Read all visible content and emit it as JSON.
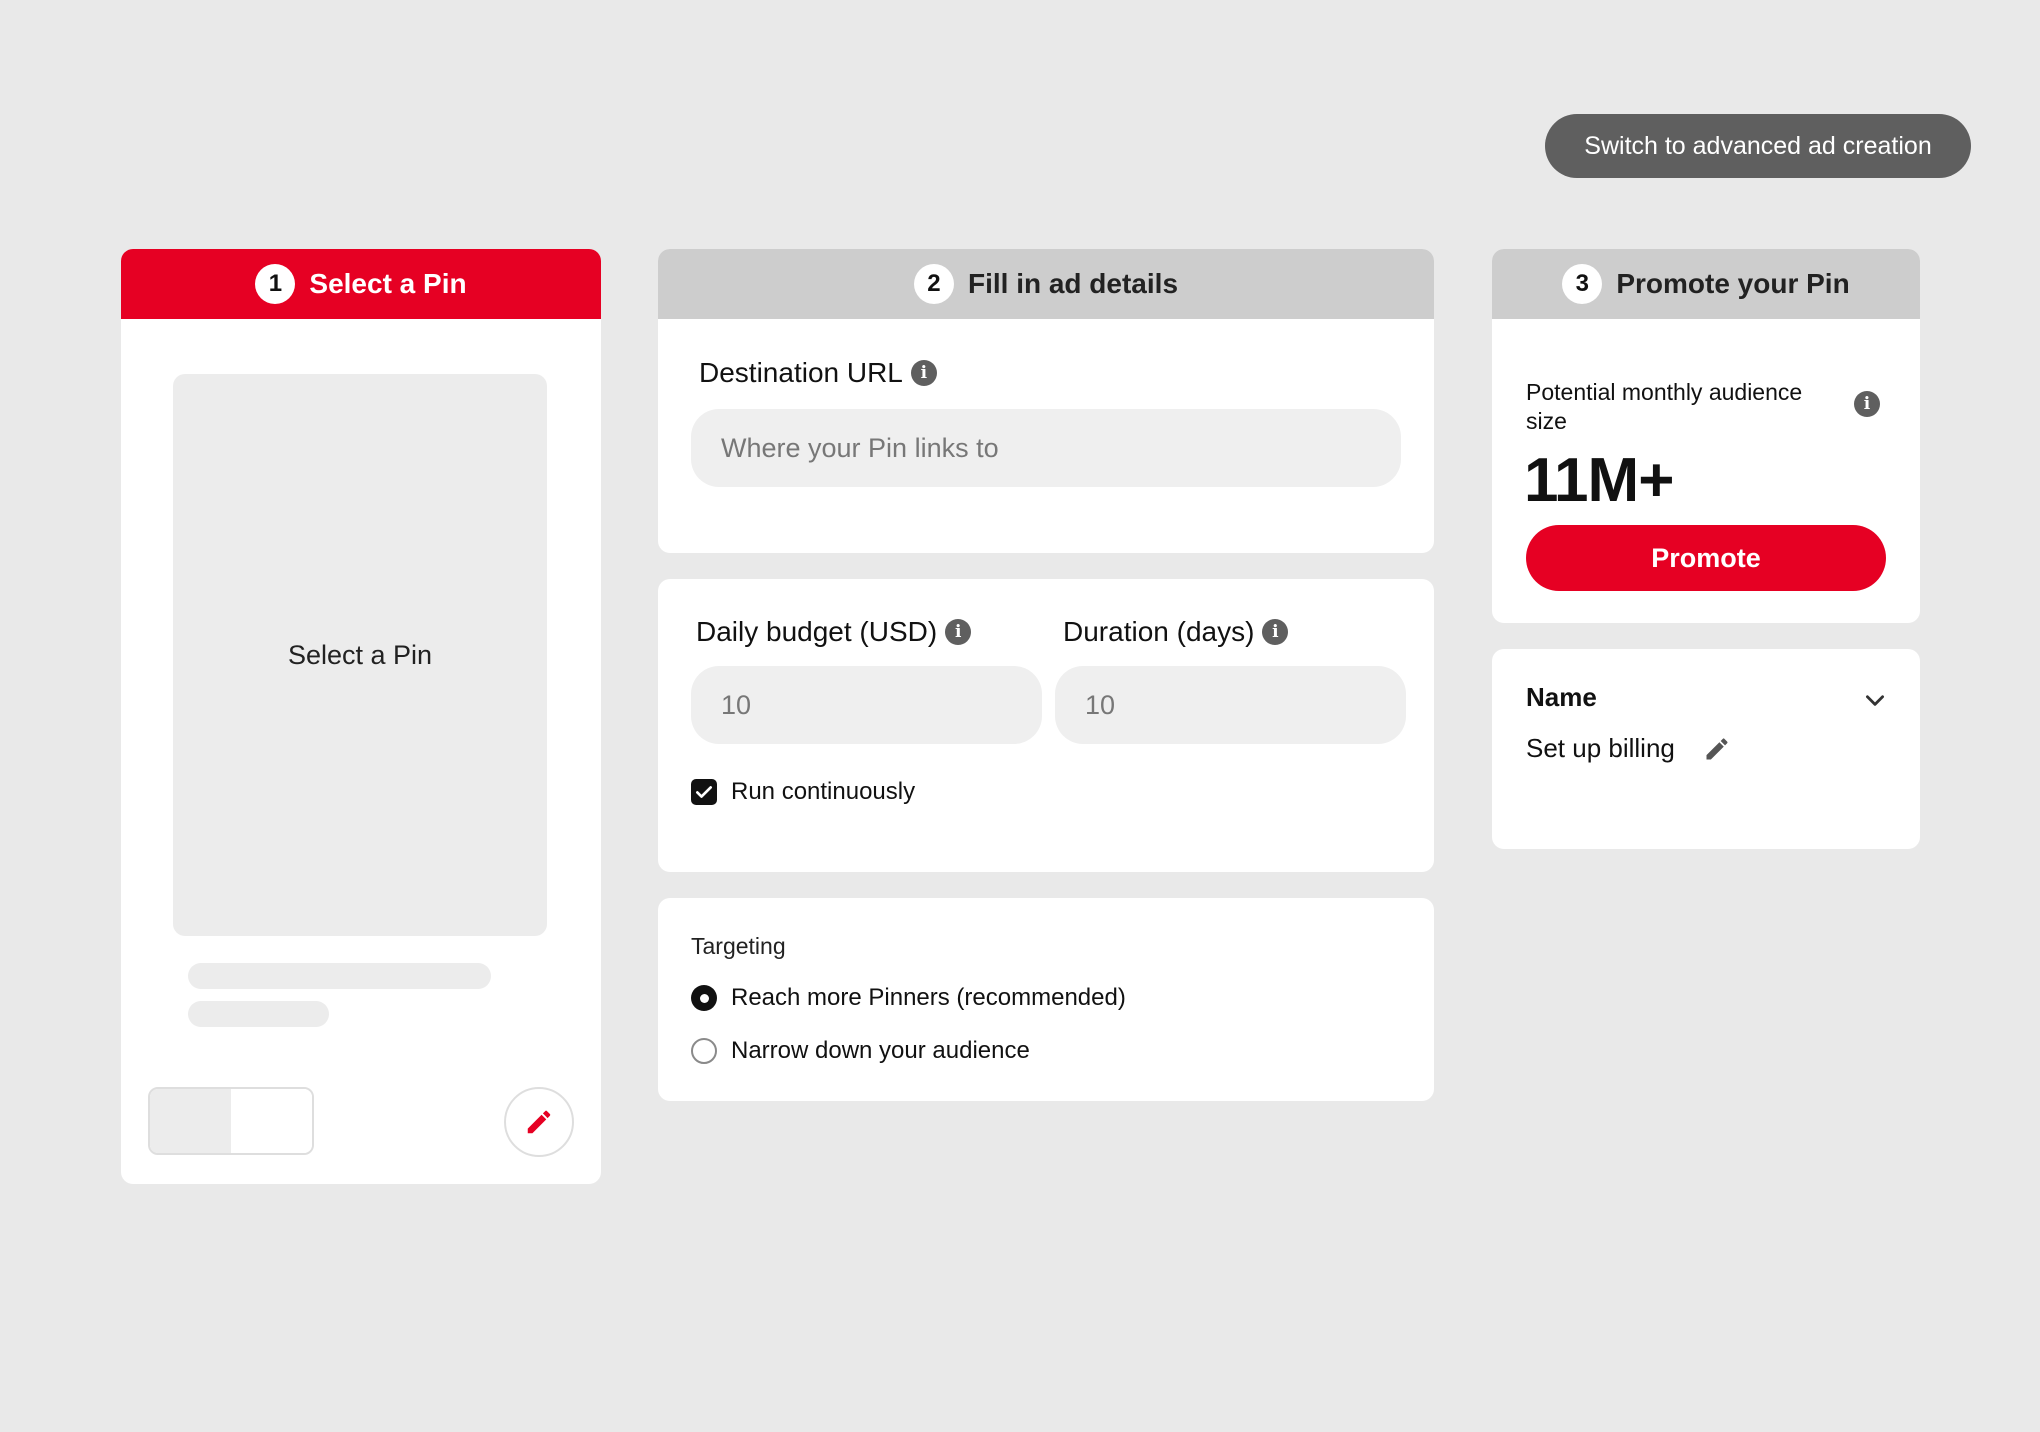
{
  "top_action": {
    "label": "Switch to advanced ad creation"
  },
  "steps": [
    {
      "number": "1",
      "title": "Select a Pin"
    },
    {
      "number": "2",
      "title": "Fill in ad details"
    },
    {
      "number": "3",
      "title": "Promote your Pin"
    }
  ],
  "pin_card": {
    "placeholder_label": "Select a Pin"
  },
  "destination": {
    "label": "Destination URL",
    "placeholder": "Where your Pin links to"
  },
  "budget": {
    "daily_label": "Daily budget (USD)",
    "daily_value": "10",
    "duration_label": "Duration (days)",
    "duration_value": "10",
    "run_continuously_label": "Run continuously",
    "run_continuously_checked": true
  },
  "targeting": {
    "title": "Targeting",
    "options": [
      {
        "label": "Reach more Pinners (recommended)",
        "selected": true
      },
      {
        "label": "Narrow down your audience",
        "selected": false
      }
    ]
  },
  "audience": {
    "label": "Potential monthly audience size",
    "value": "11M+",
    "promote_label": "Promote"
  },
  "name_section": {
    "title": "Name",
    "billing_label": "Set up billing"
  },
  "colors": {
    "accent": "#e60023",
    "background": "#e9e9e9",
    "header_grey": "#cdcdcd",
    "dark_button": "#5f5f5f"
  }
}
